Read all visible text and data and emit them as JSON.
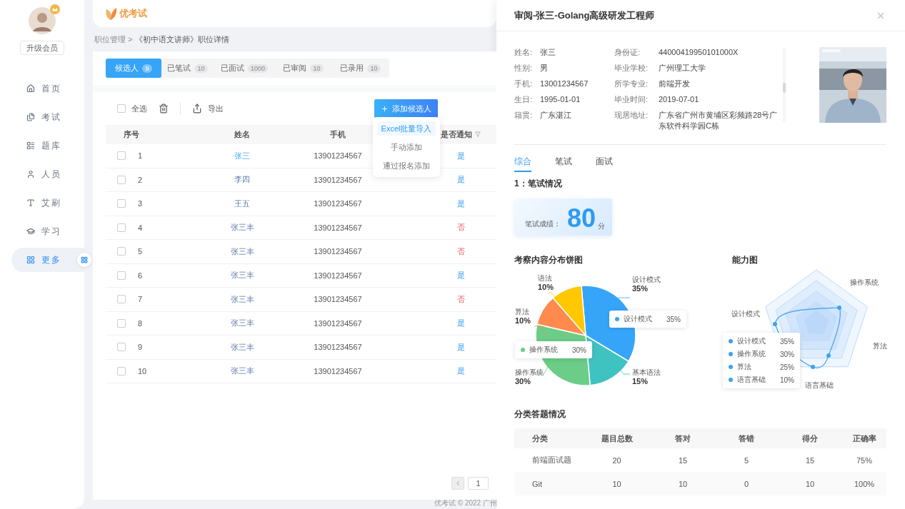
{
  "sidebar": {
    "upgrade": "升级会员",
    "items": [
      {
        "label": "首页",
        "selected": false
      },
      {
        "label": "考试",
        "selected": false
      },
      {
        "label": "题库",
        "selected": false
      },
      {
        "label": "人员",
        "selected": false
      },
      {
        "label": "艾刷",
        "selected": false
      },
      {
        "label": "学习",
        "selected": false
      },
      {
        "label": "更多",
        "selected": true
      }
    ]
  },
  "header": {
    "logo": "优考试"
  },
  "breadcrumb": {
    "parent": "职位管理 >",
    "current": "《初中语文讲师》职位详情"
  },
  "tabs": [
    {
      "label": "候选人",
      "count": "9",
      "selected": true
    },
    {
      "label": "已笔试",
      "count": "10",
      "selected": false
    },
    {
      "label": "已面试",
      "count": "1000",
      "selected": false
    },
    {
      "label": "已审阅",
      "count": "10",
      "selected": false
    },
    {
      "label": "已录用",
      "count": "10",
      "selected": false
    }
  ],
  "toolbar": {
    "select_all": "全选",
    "select_all_checked": false,
    "export": "导出",
    "add": "添加候选人"
  },
  "add_menu": [
    {
      "label": "Excel批量导入",
      "selected": true
    },
    {
      "label": "手动添加",
      "selected": false
    },
    {
      "label": "通过报名添加",
      "selected": false
    }
  ],
  "table": {
    "columns": [
      "序号",
      "姓名",
      "手机",
      "是否通知"
    ],
    "rows": [
      {
        "no": "1",
        "name": "张三",
        "hovered": true,
        "phone": "13901234567",
        "notify": "是",
        "notified": true,
        "checked": false
      },
      {
        "no": "2",
        "name": "李四",
        "hovered": false,
        "phone": "13901234567",
        "notify": "是",
        "notified": true,
        "checked": false
      },
      {
        "no": "3",
        "name": "王五",
        "hovered": false,
        "phone": "13901234567",
        "notify": "是",
        "notified": true,
        "checked": false
      },
      {
        "no": "4",
        "name": "张三丰",
        "hovered": false,
        "phone": "13901234567",
        "notify": "否",
        "notified": false,
        "checked": false
      },
      {
        "no": "5",
        "name": "张三丰",
        "hovered": false,
        "phone": "13901234567",
        "notify": "否",
        "notified": false,
        "checked": false
      },
      {
        "no": "6",
        "name": "张三丰",
        "hovered": false,
        "phone": "13901234567",
        "notify": "是",
        "notified": true,
        "checked": false
      },
      {
        "no": "7",
        "name": "张三丰",
        "hovered": false,
        "phone": "13901234567",
        "notify": "否",
        "notified": false,
        "checked": false
      },
      {
        "no": "8",
        "name": "张三丰",
        "hovered": false,
        "phone": "13901234567",
        "notify": "是",
        "notified": true,
        "checked": false
      },
      {
        "no": "9",
        "name": "张三丰",
        "hovered": false,
        "phone": "13901234567",
        "notify": "是",
        "notified": true,
        "checked": false
      },
      {
        "no": "10",
        "name": "张三丰",
        "hovered": false,
        "phone": "13901234567",
        "notify": "是",
        "notified": true,
        "checked": false
      }
    ]
  },
  "pagination": {
    "page": "1"
  },
  "footer": "优考试 © 2022 广州",
  "drawer": {
    "title": "审阅-张三-Golang高级研发工程师",
    "info_left": [
      {
        "label": "姓名:",
        "value": "张三"
      },
      {
        "label": "性别:",
        "value": "男"
      },
      {
        "label": "手机:",
        "value": "13001234567"
      },
      {
        "label": "生日:",
        "value": "1995-01-01"
      },
      {
        "label": "籍贯:",
        "value": "广东湛江"
      }
    ],
    "info_right": [
      {
        "label": "身份证:",
        "value": "44000419950101000X"
      },
      {
        "label": "毕业学校:",
        "value": "广州理工大学"
      },
      {
        "label": "所学专业:",
        "value": "前端开发"
      },
      {
        "label": "毕业时间:",
        "value": "2019-07-01"
      },
      {
        "label": "现居地址:",
        "value": "广东省广州市黄埔区彩频路28号广东软件科学园C栋"
      }
    ],
    "tabs": [
      {
        "label": "综合",
        "selected": true
      },
      {
        "label": "笔试",
        "selected": false
      },
      {
        "label": "面试",
        "selected": false
      }
    ],
    "section_title": "1：笔试情况",
    "score": {
      "label": "笔试成绩：",
      "value": "80",
      "unit": "分"
    },
    "pie": {
      "chart_data": {
        "type": "pie",
        "title": "考察内容分布饼图",
        "categories": [
          "设计模式",
          "基本语法",
          "操作系统",
          "算法",
          "语法"
        ],
        "values": [
          35,
          15,
          30,
          10,
          10
        ],
        "colors": [
          "#36a5f9",
          "#3fc3c0",
          "#6bcd87",
          "#ff8a4d",
          "#ffc800"
        ],
        "value_labels": [
          "35%",
          "15%",
          "30%",
          "10%",
          "10%"
        ]
      },
      "tooltip": {
        "label": "设计模式",
        "value": "35%"
      },
      "highlight": {
        "label": "操作系统",
        "value": "30%"
      }
    },
    "radar": {
      "title": "能力图",
      "axes": [
        "操作系统",
        "算法",
        "语言基础",
        "设计模式"
      ],
      "tooltip": [
        {
          "label": "设计模式",
          "value": "35%"
        },
        {
          "label": "操作系统",
          "value": "30%"
        },
        {
          "label": "算法",
          "value": "25%"
        },
        {
          "label": "语言基础",
          "value": "10%"
        }
      ]
    },
    "category_title": "分类答题情况",
    "category_table": {
      "columns": [
        "分类",
        "题目总数",
        "答对",
        "答错",
        "得分",
        "正确率"
      ],
      "rows": [
        [
          "前端面试题",
          "20",
          "15",
          "5",
          "15",
          "75%"
        ],
        [
          "Git",
          "10",
          "10",
          "0",
          "10",
          "100%"
        ]
      ]
    }
  }
}
